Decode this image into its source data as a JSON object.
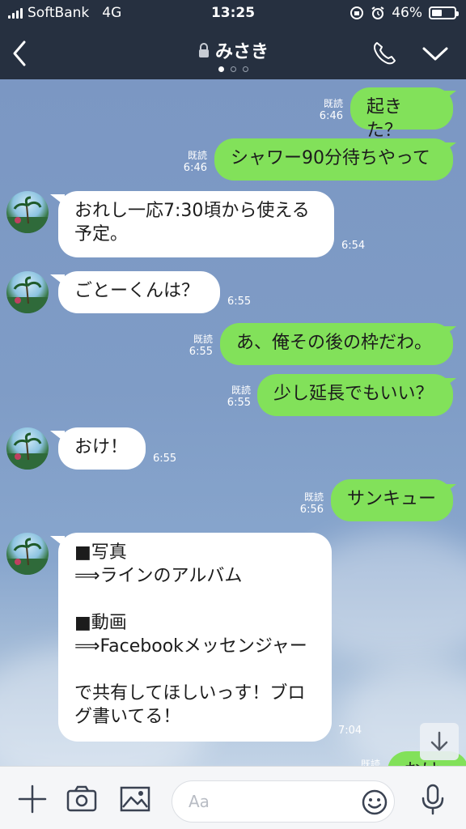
{
  "status_bar": {
    "carrier": "SoftBank",
    "network": "4G",
    "time": "13:25",
    "battery": "46%",
    "battery_level": 0.46
  },
  "header": {
    "title": "みさき",
    "page_dots": 3,
    "active_dot": 0
  },
  "messages": [
    {
      "dir": "out",
      "text": "起きた？",
      "read": "既読",
      "time": "6:46"
    },
    {
      "dir": "out",
      "text": "シャワー90分待ちやって",
      "read": "既読",
      "time": "6:46"
    },
    {
      "dir": "in",
      "text": "おれし一応7:30頃から使える\n予定。",
      "time": "6:54"
    },
    {
      "dir": "in",
      "text": "ごとーくんは？",
      "time": "6:55"
    },
    {
      "dir": "out",
      "text": "あ、俺その後の枠だわ。",
      "read": "既読",
      "time": "6:55"
    },
    {
      "dir": "out",
      "text": "少し延長でもいい？",
      "read": "既読",
      "time": "6:55"
    },
    {
      "dir": "in",
      "text": "おけ！",
      "time": "6:55"
    },
    {
      "dir": "out",
      "text": "サンキュー",
      "read": "既読",
      "time": "6:56"
    },
    {
      "dir": "in",
      "text": "■写真\n⟹ラインのアルバム\n\n■動画\n⟹Facebookメッセンジャー\n\nで共有してほしいっす！ブロ\nグ書いてる！",
      "time": "7:04"
    },
    {
      "dir": "out",
      "text": "おけ",
      "read": "既読",
      "time": ""
    }
  ],
  "input": {
    "placeholder": "Aa"
  },
  "icons": {
    "back": "chevron-left-icon",
    "lock": "lock-icon",
    "call": "phone-icon",
    "menu": "chevron-down-icon",
    "plus": "plus-icon",
    "camera": "camera-icon",
    "image": "image-icon",
    "emoji": "emoji-icon",
    "mic": "microphone-icon",
    "scroll": "arrow-down-icon"
  },
  "colors": {
    "header_bg": "#263040",
    "bubble_out": "#82e15a",
    "bubble_in": "#ffffff",
    "chat_bg": "#7d98c2"
  }
}
